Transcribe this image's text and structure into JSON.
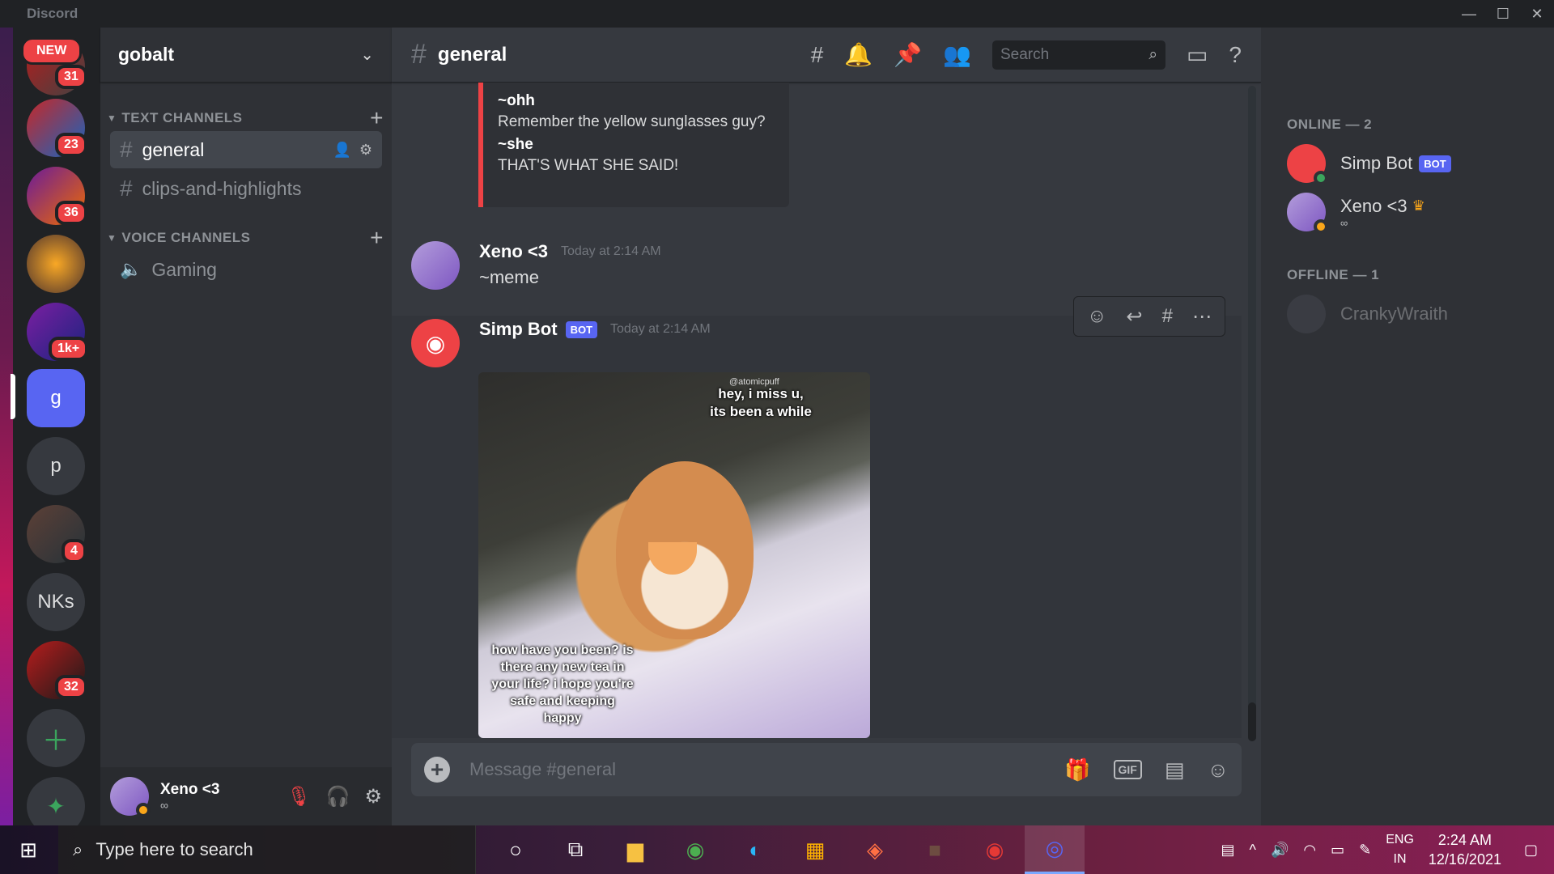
{
  "window": {
    "app_name": "Discord",
    "controls": [
      "—",
      "☐",
      "✕"
    ]
  },
  "servers": [
    {
      "label": "",
      "badge": "31",
      "new": "NEW",
      "colors": [
        "#b71c1c",
        "#424242"
      ]
    },
    {
      "label": "",
      "badge": "23",
      "colors": [
        "#c62828",
        "#1565c0"
      ]
    },
    {
      "label": "",
      "badge": "36",
      "colors": [
        "#6a1b9a",
        "#ef6c00"
      ]
    },
    {
      "label": "",
      "badge": "",
      "colors": [
        "#f9a825",
        "#4e342e"
      ]
    },
    {
      "label": "",
      "badge": "1k+",
      "colors": [
        "#7b1fa2",
        "#1a237e"
      ]
    },
    {
      "label": "g",
      "badge": "",
      "colors": [
        "#5865f2",
        "#5865f2"
      ]
    },
    {
      "label": "p",
      "badge": "",
      "colors": [
        "#36393f",
        "#36393f"
      ]
    },
    {
      "label": "",
      "badge": "4",
      "colors": [
        "#5d4037",
        "#263238"
      ]
    },
    {
      "label": "NKs",
      "badge": "",
      "colors": [
        "#36393f",
        "#36393f"
      ]
    },
    {
      "label": "",
      "badge": "32",
      "colors": [
        "#b71c1c",
        "#1a1a1a"
      ]
    }
  ],
  "guild": {
    "name": "gobalt",
    "text_category": "TEXT CHANNELS",
    "voice_category": "VOICE CHANNELS",
    "text_channels": [
      "general",
      "clips-and-highlights"
    ],
    "voice_channels": [
      "Gaming"
    ]
  },
  "user": {
    "name": "Xeno <3",
    "status_text": "∞"
  },
  "chat": {
    "channel": "general",
    "search_placeholder": "Search",
    "embed": [
      {
        "k": "~ohh",
        "v": "Remember the yellow sunglasses guy?"
      },
      {
        "k": "~she",
        "v": "THAT'S WHAT SHE SAID!"
      }
    ],
    "messages": [
      {
        "author": "Xeno <3",
        "time": "Today at 2:14 AM",
        "text": "~meme"
      },
      {
        "author": "Simp Bot",
        "bot": "BOT",
        "time": "Today at 2:14 AM",
        "meme_top": "hey, i miss u, its been a while",
        "meme_bottom": "how have you been? is there any new tea in your life? i hope you're safe and keeping happy",
        "meme_watermark": "@atomicpuff"
      }
    ],
    "composer_placeholder": "Message #general"
  },
  "members": {
    "online_header": "ONLINE — 2",
    "offline_header": "OFFLINE — 1",
    "online": [
      {
        "name": "Simp Bot",
        "badge": "BOT",
        "status": "online"
      },
      {
        "name": "Xeno <3",
        "sub": "∞",
        "crown": "♛",
        "status": "idle"
      }
    ],
    "offline": [
      {
        "name": "CrankyWraith"
      }
    ]
  },
  "taskbar": {
    "search_placeholder": "Type here to search",
    "lang": "ENG",
    "lang_sub": "IN",
    "time": "2:24 AM",
    "date": "12/16/2021"
  },
  "colors": {
    "accent": "#5865f2",
    "danger": "#ed4245",
    "online": "#3ba55d",
    "idle": "#faa61a"
  }
}
